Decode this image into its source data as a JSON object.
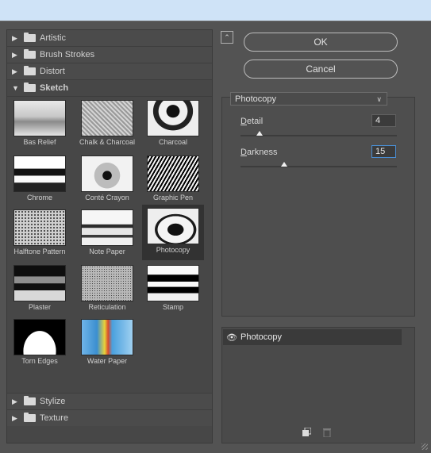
{
  "categories_top": [
    {
      "label": "Artistic",
      "open": false
    },
    {
      "label": "Brush Strokes",
      "open": false
    },
    {
      "label": "Distort",
      "open": false
    },
    {
      "label": "Sketch",
      "open": true
    }
  ],
  "categories_bottom": [
    {
      "label": "Stylize"
    },
    {
      "label": "Texture"
    }
  ],
  "thumbnails": [
    {
      "label": "Bas Relief"
    },
    {
      "label": "Chalk & Charcoal"
    },
    {
      "label": "Charcoal"
    },
    {
      "label": "Chrome"
    },
    {
      "label": "Conté Crayon"
    },
    {
      "label": "Graphic Pen"
    },
    {
      "label": "Halftone Pattern"
    },
    {
      "label": "Note Paper"
    },
    {
      "label": "Photocopy"
    },
    {
      "label": "Plaster"
    },
    {
      "label": "Reticulation"
    },
    {
      "label": "Stamp"
    },
    {
      "label": "Torn Edges"
    },
    {
      "label": "Water Paper"
    }
  ],
  "selected_thumbnail": "Photocopy",
  "buttons": {
    "ok": "OK",
    "cancel": "Cancel"
  },
  "filter_dropdown": {
    "value": "Photocopy"
  },
  "params": {
    "detail": {
      "label_first": "D",
      "label_rest": "etail",
      "value": "4",
      "level": 0.12
    },
    "darkness": {
      "label_first": "D",
      "label_rest": "arkness",
      "value": "15",
      "level": 0.28
    }
  },
  "layers": [
    {
      "label": "Photocopy"
    }
  ],
  "icons": {
    "collapse": "collapse-icon",
    "eye": "eye-icon",
    "new_layer": "new-effect-layer-icon",
    "delete": "trash-icon",
    "folder": "folder-icon"
  },
  "colors": {
    "dialog_bg": "#535353",
    "focus": "#4a8fd6",
    "selected_row": "#3a3a3a"
  }
}
